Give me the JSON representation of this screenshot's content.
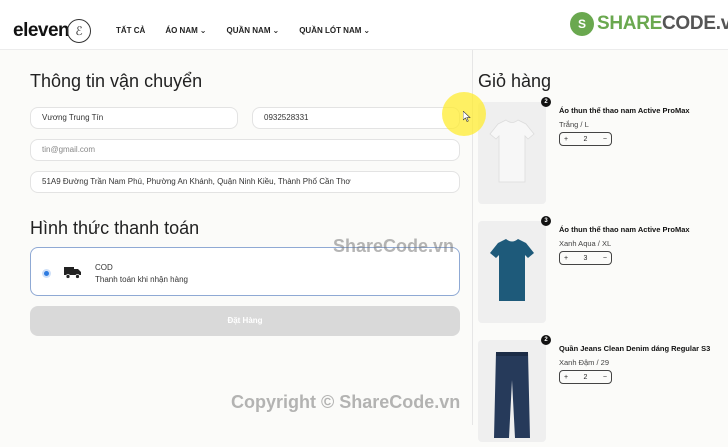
{
  "header": {
    "logo": "eleven",
    "logo_mark": "ℰ",
    "nav": [
      {
        "label": "TẤT CẢ",
        "dropdown": false
      },
      {
        "label": "ÁO NAM",
        "dropdown": true
      },
      {
        "label": "QUẦN NAM",
        "dropdown": true
      },
      {
        "label": "QUẦN LÓT NAM",
        "dropdown": true
      }
    ],
    "brand": {
      "prefix": "SHARE",
      "suffix": "CODE.vn"
    }
  },
  "shipping": {
    "title": "Thông tin vận chuyển",
    "name_value": "Vương Trung Tín",
    "phone_value": "0932528331",
    "email_placeholder": "tin@gmail.com",
    "address_value": "51A9 Đường Trần Nam Phú, Phường An Khánh, Quận Ninh Kiều, Thành Phố Cần Thơ"
  },
  "payment": {
    "title": "Hình thức thanh toán",
    "method_code": "COD",
    "method_desc": "Thanh toán khi nhận hàng",
    "selected": true
  },
  "order_button": "Đặt Hàng",
  "cart": {
    "title": "Giỏ hàng",
    "items": [
      {
        "qty_badge": "2",
        "name": "Áo thun thể thao nam Active ProMax",
        "variant": "Trắng / L",
        "qty": "2",
        "minus": "−",
        "plus": "+",
        "image": "white-tshirt",
        "color": "#f2f2f2"
      },
      {
        "qty_badge": "3",
        "name": "Áo thun thể thao nam Active ProMax",
        "variant": "Xanh Aqua / XL",
        "qty": "3",
        "minus": "−",
        "plus": "+",
        "image": "teal-tshirt",
        "color": "#1e5a7a"
      },
      {
        "qty_badge": "2",
        "name": "Quần Jeans Clean Denim dáng Regular S3",
        "variant": "Xanh Đậm / 29",
        "qty": "2",
        "minus": "−",
        "plus": "+",
        "image": "jeans",
        "color": "#263a5a"
      }
    ]
  },
  "watermarks": {
    "center": "ShareCode.vn",
    "bottom": "Copyright © ShareCode.vn"
  }
}
